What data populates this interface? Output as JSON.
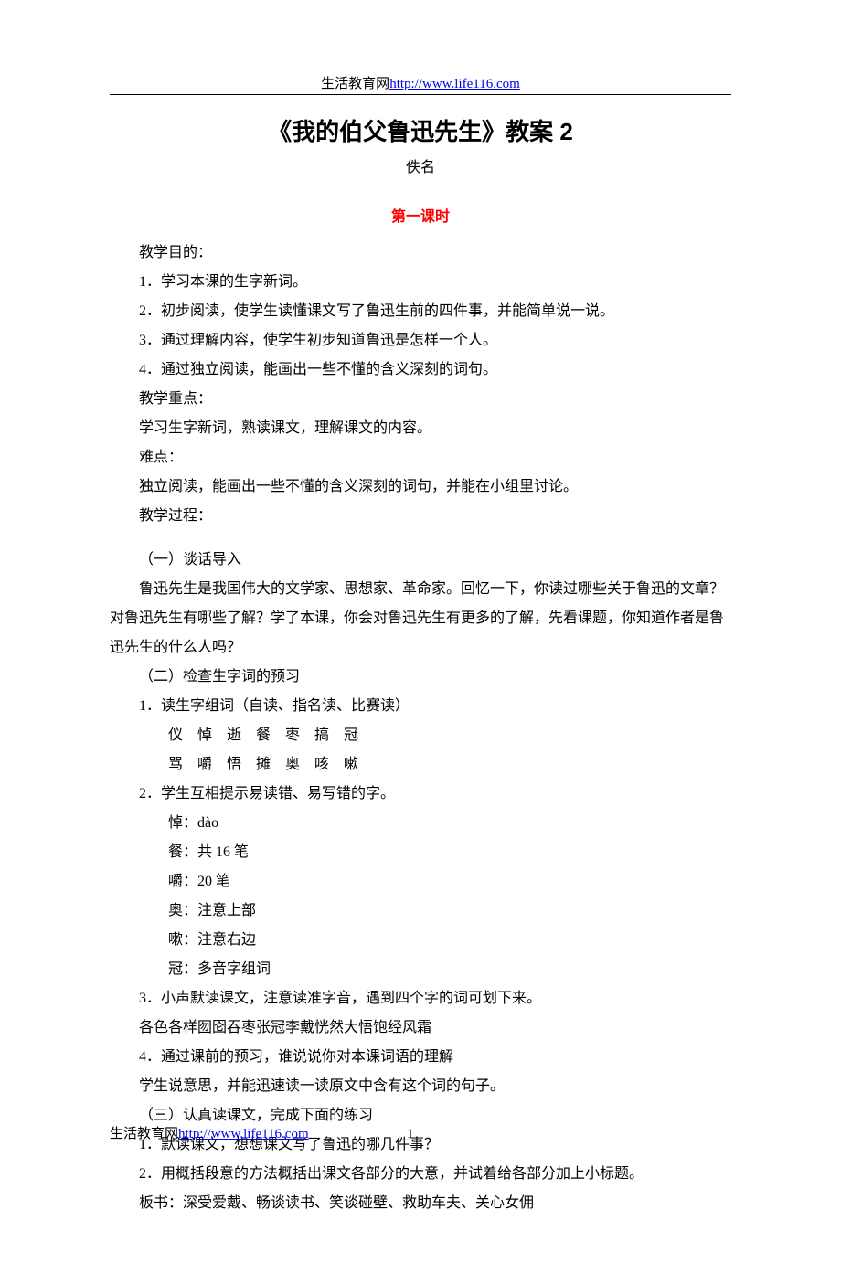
{
  "header": {
    "site_name": "生活教育网",
    "url": "http://www.life116.com"
  },
  "title": "《我的伯父鲁迅先生》教案 2",
  "author": "佚名",
  "section_label": "第一课时",
  "lines": {
    "l1": "教学目的：",
    "l2": "1．学习本课的生字新词。",
    "l3": "2．初步阅读，使学生读懂课文写了鲁迅生前的四件事，并能简单说一说。",
    "l4": "3．通过理解内容，使学生初步知道鲁迅是怎样一个人。",
    "l5": "4．通过独立阅读，能画出一些不懂的含义深刻的词句。",
    "l6": "教学重点：",
    "l7": "学习生字新词，熟读课文，理解课文的内容。",
    "l8": "难点：",
    "l9": "独立阅读，能画出一些不懂的含义深刻的词句，并能在小组里讨论。",
    "l10": "教学过程：",
    "l11": "（一）谈话导入",
    "l12": "鲁迅先生是我国伟大的文学家、思想家、革命家。回忆一下，你读过哪些关于鲁迅的文章？对鲁迅先生有哪些了解？学了本课，你会对鲁迅先生有更多的了解，先看课题，你知道作者是鲁迅先生的什么人吗？",
    "l13": "（二）检查生字词的预习",
    "l14": "1．读生字组词（自读、指名读、比赛读）",
    "l15": "仪　悼　逝　餐　枣　搞　冠",
    "l16": "骂　嚼　悟　摊　奥　咳　嗽",
    "l17": "2．学生互相提示易读错、易写错的字。",
    "l18": "悼：dào",
    "l19": "餐：共 16 笔",
    "l20": "嚼：20 笔",
    "l21": "奥：注意上部",
    "l22": "嗽：注意右边",
    "l23": "冠：多音字组词",
    "l24": "3．小声默读课文，注意读准字音，遇到四个字的词可划下来。",
    "l25": "各色各样囫囵吞枣张冠李戴恍然大悟饱经风霜",
    "l26": "4．通过课前的预习，谁说说你对本课词语的理解",
    "l27": "学生说意思，并能迅速读一读原文中含有这个词的句子。",
    "l28": "（三）认真读课文，完成下面的练习",
    "l29": "1．默读课文，想想课文写了鲁迅的哪几件事？",
    "l30": "2．用概括段意的方法概括出课文各部分的大意，并试着给各部分加上小标题。",
    "l31": "板书：深受爱戴、畅谈读书、笑谈碰壁、救助车夫、关心女佣"
  },
  "footer": {
    "site_name": "生活教育网",
    "url": "http://www.life116.com",
    "page": "1"
  }
}
